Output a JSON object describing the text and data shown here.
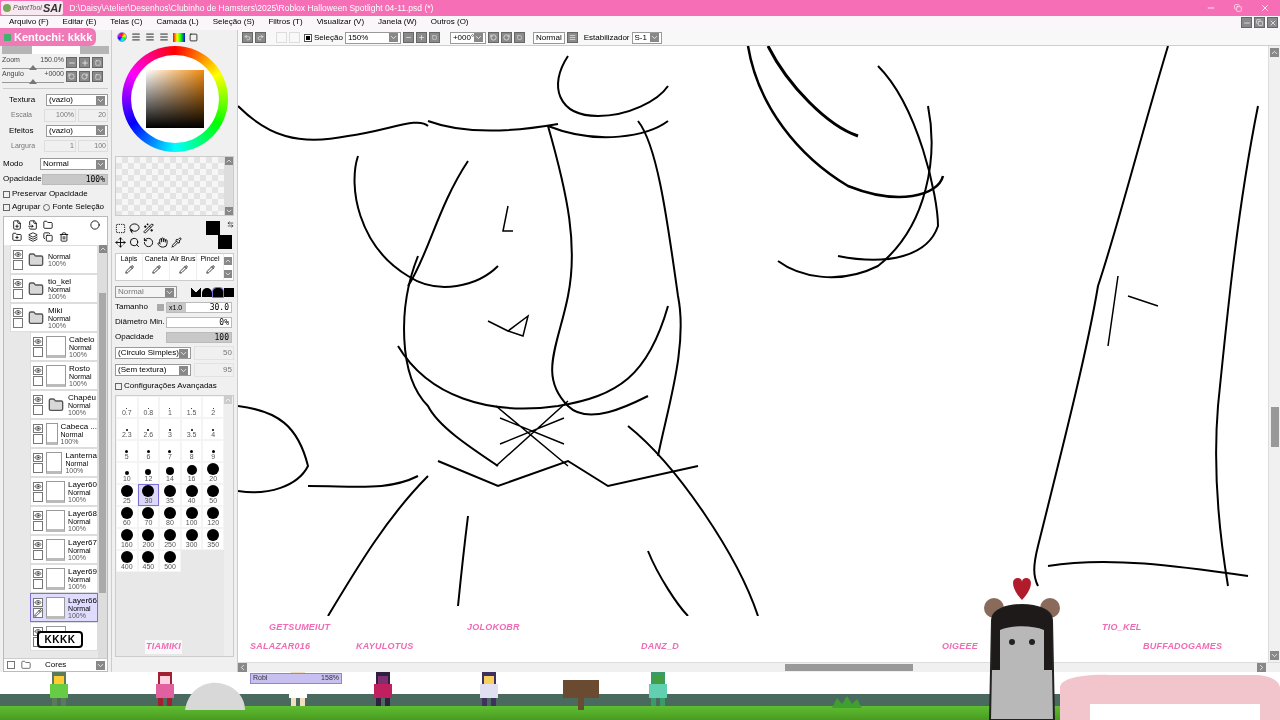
{
  "title_bar": {
    "logo_light": "PaintTool",
    "logo_bold": "SAI",
    "path": "D:\\Daisy\\Atelier\\Desenhos\\Clubinho de Hamsters\\2025\\Roblox Halloween Spotlight 04-11.psd (*)"
  },
  "menu": [
    "Arquivo (F)",
    "Editar (E)",
    "Telas (C)",
    "Camada (L)",
    "Seleção (S)",
    "Filtros (T)",
    "Visualizar (V)",
    "Janela (W)",
    "Outros (O)"
  ],
  "chat_message": "Kentochi: kkkk",
  "toolbar": {
    "selection_label": "Seleção",
    "selection_checked": true,
    "zoom": "150%",
    "angle": "+000°",
    "blend": "Normal",
    "stabilizer_label": "Estabilizador",
    "stabilizer": "S-1"
  },
  "navigator": {
    "zoom": {
      "label": "Zoom",
      "value": "150.0%",
      "level": 0.5
    },
    "angle": {
      "label": "Angulo",
      "value": "+0000",
      "level": 0.5
    }
  },
  "layer_props": {
    "texture_label": "Textura",
    "texture_value": "(vazio)",
    "scale_label": "Escala",
    "scale_value": "100%",
    "scale_num": "20",
    "effects_label": "Efeitos",
    "effects_value": "(vazio)",
    "width_label": "Largura",
    "width_value": "1",
    "width_num": "100",
    "mode_label": "Modo",
    "mode_value": "Normal",
    "opacity_label": "Opacidade",
    "opacity": {
      "value": "100%",
      "level": 1
    }
  },
  "layer_options": [
    {
      "kind": "checkbox",
      "label": "Preservar Opacidade",
      "checked": false
    },
    {
      "kind": "checkbox",
      "label": "Agrupar",
      "checked": false
    },
    {
      "kind": "radio",
      "label": "Fonte Seleção",
      "checked": false
    }
  ],
  "layers": [
    {
      "kind": "folder",
      "mode": "Normal",
      "opacity": "100%",
      "visible": true,
      "selected": false
    },
    {
      "kind": "folder",
      "name": "tio_kel",
      "mode": "Normal",
      "opacity": "100%",
      "visible": true,
      "selected": false
    },
    {
      "kind": "folder",
      "name": "Miki",
      "mode": "Normal",
      "opacity": "100%",
      "visible": true,
      "selected": false,
      "children": [
        {
          "kind": "layer",
          "name": "Cabelo",
          "mode": "Normal",
          "opacity": "100%",
          "visible": true,
          "selected": false
        },
        {
          "kind": "layer",
          "name": "Rosto",
          "mode": "Normal",
          "opacity": "100%",
          "visible": true,
          "selected": false
        },
        {
          "kind": "folder",
          "name": "Chapéu",
          "mode": "Normal",
          "opacity": "100%",
          "visible": true,
          "selected": false
        },
        {
          "kind": "layer",
          "name": "Cabeca ...",
          "mode": "Normal",
          "opacity": "100%",
          "visible": true,
          "selected": false
        },
        {
          "kind": "layer",
          "name": "Lanterna",
          "mode": "Normal",
          "opacity": "100%",
          "visible": true,
          "selected": false
        },
        {
          "kind": "layer",
          "name": "Layer60",
          "mode": "Normal",
          "opacity": "100%",
          "visible": true,
          "selected": false
        },
        {
          "kind": "layer",
          "name": "Layer68",
          "mode": "Normal",
          "opacity": "100%",
          "visible": true,
          "selected": false
        },
        {
          "kind": "layer",
          "name": "Layer67",
          "mode": "Normal",
          "opacity": "100%",
          "visible": true,
          "selected": false
        },
        {
          "kind": "layer",
          "name": "Layer69",
          "mode": "Normal",
          "opacity": "100%",
          "visible": true,
          "selected": false
        },
        {
          "kind": "layer",
          "name": "Layer66",
          "mode": "Normal",
          "opacity": "100%",
          "visible": true,
          "selected": true
        },
        {
          "kind": "layer",
          "visible": true,
          "selected": false
        }
      ]
    },
    {
      "kind": "folder",
      "name": "Cores",
      "selected": false
    }
  ],
  "chat_bubble": "KKKK",
  "brush_tools": [
    {
      "label": "Lápis",
      "selected": false
    },
    {
      "label": "Caneta",
      "selected": false
    },
    {
      "label": "Air Brus",
      "selected": false
    },
    {
      "label": "Pincel",
      "selected": false
    }
  ],
  "brush_settings": {
    "blend": "Normal",
    "size_label": "Tamanho",
    "size": {
      "mult": "x1.0",
      "value": "30.0",
      "level": 0.3
    },
    "min_label": "Diâmetro Min.",
    "min": {
      "value": "0%",
      "level": 0
    },
    "opacity_label": "Opacidade",
    "opacity": {
      "value": "100",
      "level": 1
    },
    "shape": "(Circulo Simples)",
    "shape_value": "50",
    "texture": "(Sem textura)",
    "texture_value": "95",
    "advanced_label": "Configurações Avançadas",
    "advanced_checked": false
  },
  "brush_sizes": [
    {
      "size": "0.7",
      "selected": false
    },
    {
      "size": "0.8",
      "selected": false
    },
    {
      "size": "1",
      "selected": false
    },
    {
      "size": "1.5",
      "selected": false
    },
    {
      "size": "2",
      "selected": false
    },
    {
      "size": "2.3",
      "selected": false
    },
    {
      "size": "2.6",
      "selected": false
    },
    {
      "size": "3",
      "selected": false
    },
    {
      "size": "3.5",
      "selected": false
    },
    {
      "size": "4",
      "selected": false
    },
    {
      "size": "5",
      "selected": false
    },
    {
      "size": "6",
      "selected": false
    },
    {
      "size": "7",
      "selected": false
    },
    {
      "size": "8",
      "selected": false
    },
    {
      "size": "9",
      "selected": false
    },
    {
      "size": "10",
      "selected": false
    },
    {
      "size": "12",
      "selected": false
    },
    {
      "size": "14",
      "selected": false
    },
    {
      "size": "16",
      "selected": false
    },
    {
      "size": "20",
      "selected": false
    },
    {
      "size": "25",
      "selected": false
    },
    {
      "size": "30",
      "selected": true
    },
    {
      "size": "35",
      "selected": false
    },
    {
      "size": "40",
      "selected": false
    },
    {
      "size": "50",
      "selected": false
    },
    {
      "size": "60",
      "selected": false
    },
    {
      "size": "70",
      "selected": false
    },
    {
      "size": "80",
      "selected": false
    },
    {
      "size": "100",
      "selected": false
    },
    {
      "size": "120",
      "selected": false
    },
    {
      "size": "160",
      "selected": false
    },
    {
      "size": "200",
      "selected": false
    },
    {
      "size": "250",
      "selected": false
    },
    {
      "size": "300",
      "selected": false
    },
    {
      "size": "350",
      "selected": false
    },
    {
      "size": "400",
      "selected": false
    },
    {
      "size": "450",
      "selected": false
    },
    {
      "size": "500",
      "selected": false
    }
  ],
  "stream_names": [
    "TIAMIKI",
    "GETSUMEIUT",
    "SALAZAR016",
    "KAYULOTUS",
    "JOLOKOBR",
    "DANZ_D",
    "OIGEEE",
    "TIO_KEL",
    "BUFFADOGAMES"
  ],
  "nameplate": {
    "text": "Robl",
    "value": "158%"
  }
}
